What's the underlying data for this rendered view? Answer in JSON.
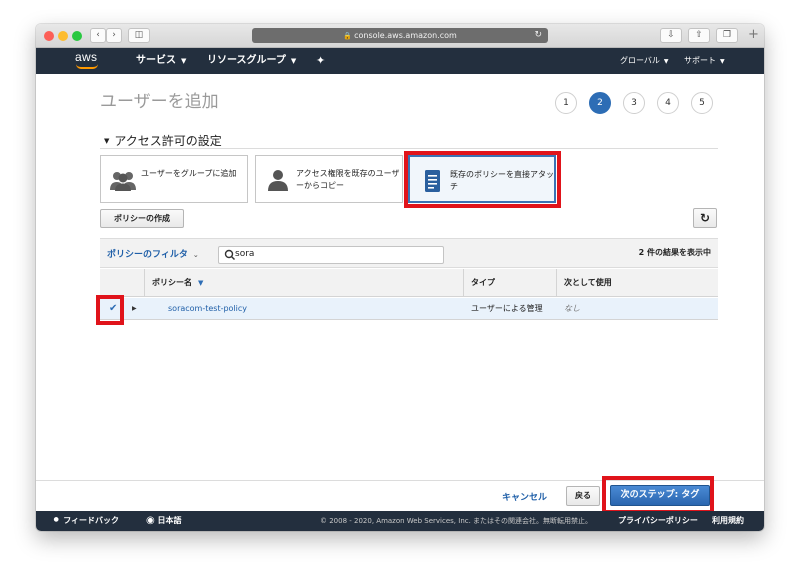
{
  "browser": {
    "url": "console.aws.amazon.com",
    "traffic_light_colors": [
      "#fc5f57",
      "#fdbc2e",
      "#28c840"
    ]
  },
  "nav": {
    "logo": "aws",
    "services": "サービス",
    "resource_groups": "リソースグループ",
    "global": "グローバル",
    "support": "サポート"
  },
  "page": {
    "title": "ユーザーを追加",
    "steps": [
      "1",
      "2",
      "3",
      "4",
      "5"
    ],
    "active_step": "2",
    "section_title": "アクセス許可の設定"
  },
  "options": [
    {
      "label": "ユーザーをグループに追加",
      "icon": "users-group-icon"
    },
    {
      "label": "アクセス権限を既存のユーザーからコピー",
      "icon": "user-icon"
    },
    {
      "label": "既存のポリシーを直接アタッチ",
      "icon": "document-icon"
    }
  ],
  "buttons": {
    "create_policy": "ポリシーの作成",
    "refresh_icon": "refresh-icon"
  },
  "filter": {
    "label": "ポリシーのフィルタ",
    "search_value": "sora",
    "results": "2 件の結果を表示中"
  },
  "table": {
    "headers": [
      "ポリシー名",
      "タイプ",
      "次として使用"
    ],
    "rows": [
      {
        "checked": true,
        "name": "soracom-test-policy",
        "type": "ユーザーによる管理",
        "used_as": "なし"
      }
    ]
  },
  "actions": {
    "cancel": "キャンセル",
    "back": "戻る",
    "next": "次のステップ: タグ"
  },
  "footer": {
    "feedback": "フィードバック",
    "language": "日本語",
    "copyright": "© 2008 - 2020, Amazon Web Services, Inc. またはその関連会社。無断転用禁止。",
    "privacy": "プライバシーポリシー",
    "terms": "利用規約"
  },
  "colors": {
    "aws_nav": "#232f3e",
    "accent_blue": "#2d6db5",
    "highlight_red": "#e0131a",
    "orange": "#ff9900"
  }
}
